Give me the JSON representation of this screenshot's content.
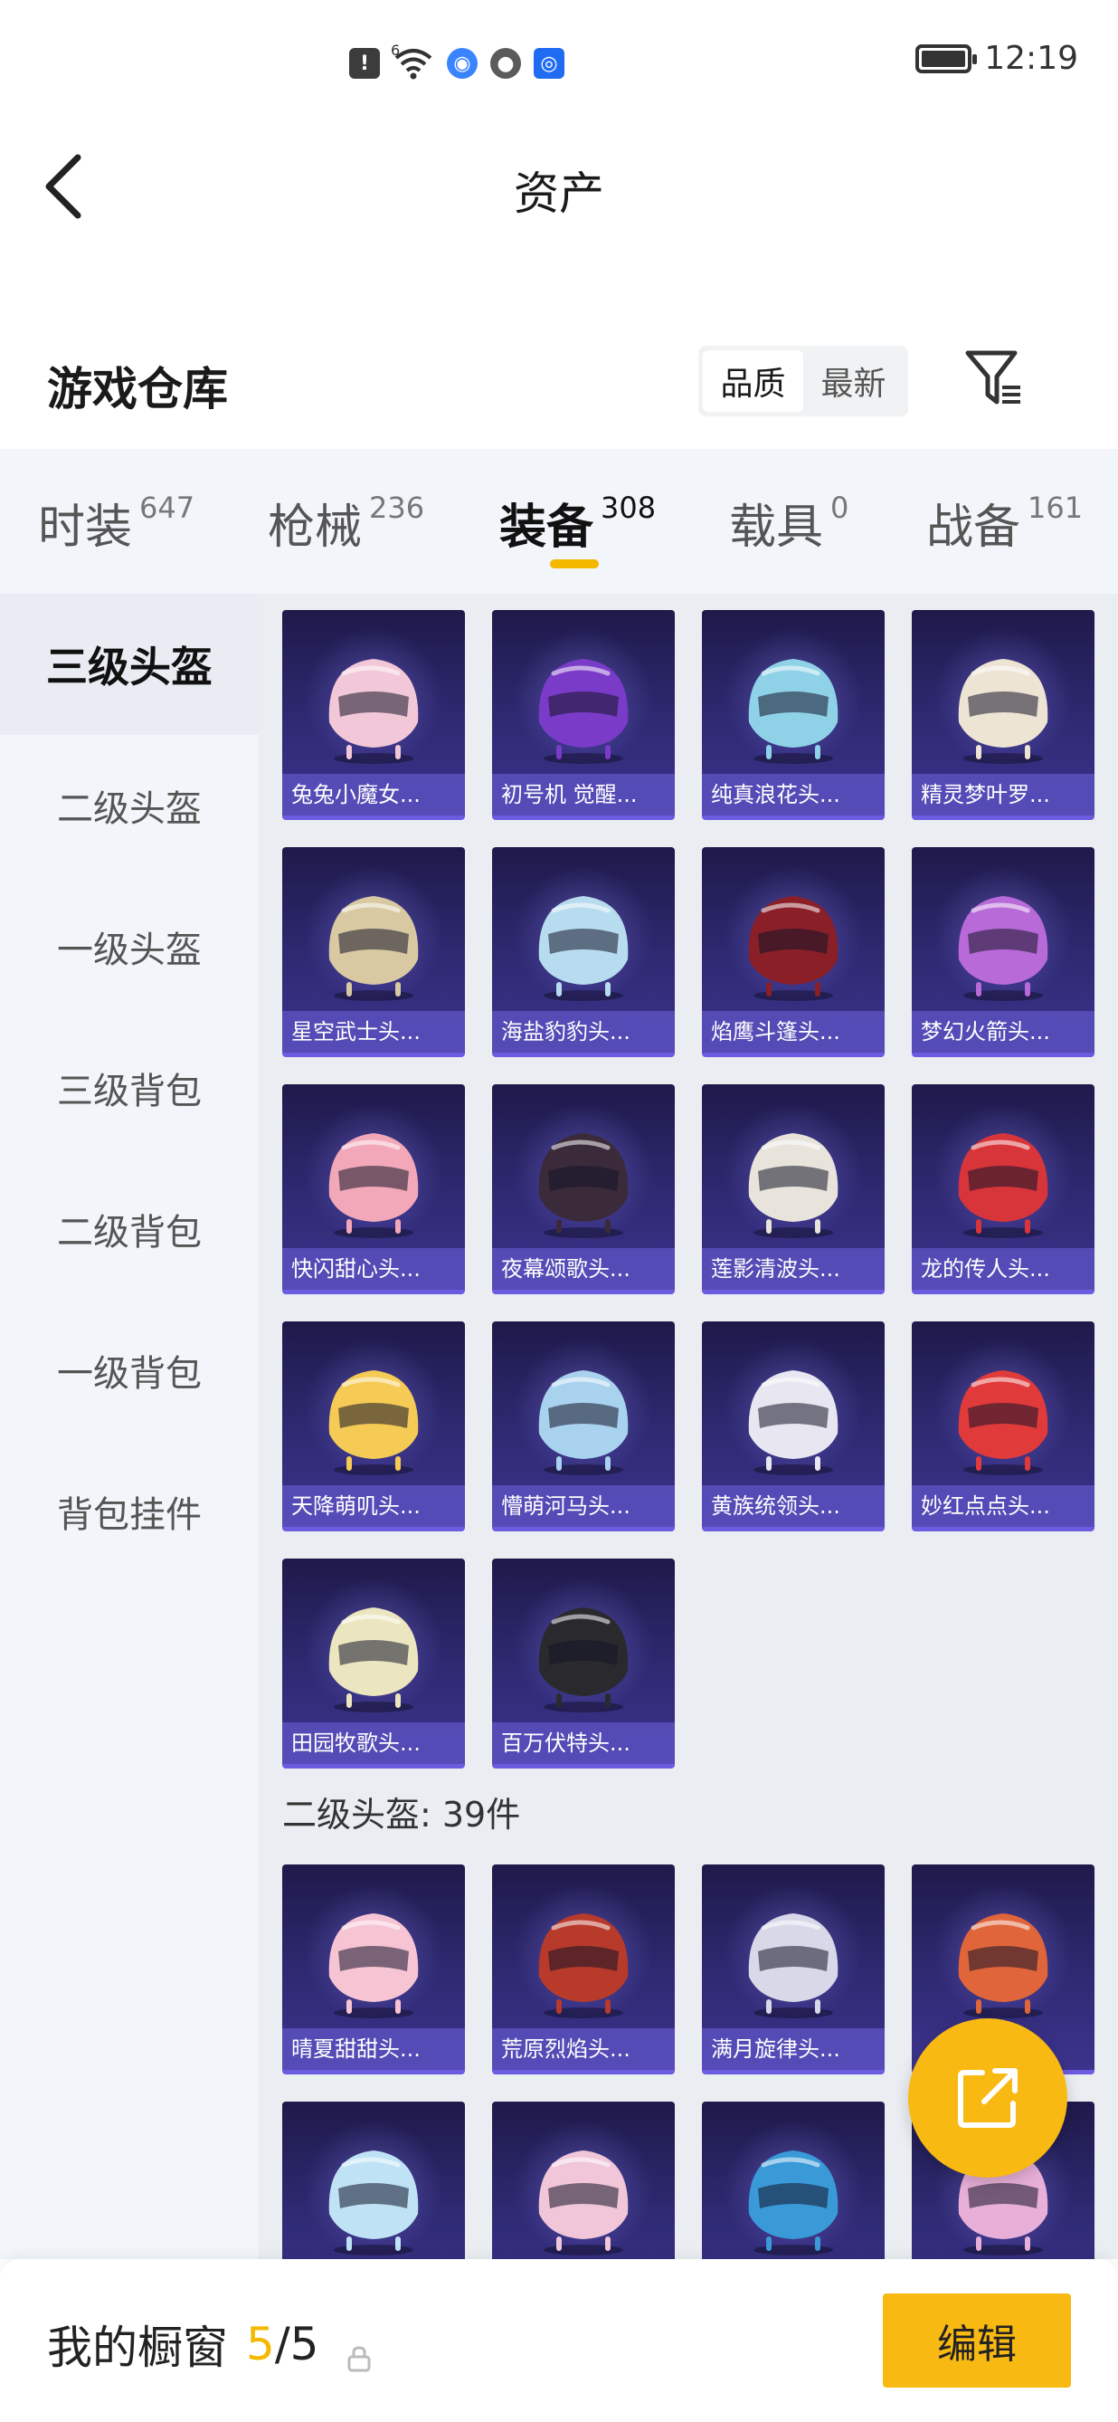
{
  "status_bar": {
    "time": "12:19",
    "signal_superscript": "6",
    "icons": [
      "alert-icon",
      "wifi-icon",
      "browser-icon",
      "wechat-icon",
      "app-icon"
    ]
  },
  "header": {
    "title": "资产"
  },
  "warehouse": {
    "title": "游戏仓库",
    "sort_options": [
      "品质",
      "最新"
    ],
    "active_sort": "品质"
  },
  "categories": [
    {
      "label": "时装",
      "count": "647"
    },
    {
      "label": "枪械",
      "count": "236"
    },
    {
      "label": "装备",
      "count": "308",
      "active": true
    },
    {
      "label": "载具",
      "count": "0"
    },
    {
      "label": "战备",
      "count": "161"
    }
  ],
  "sidebar": {
    "items": [
      {
        "label": "三级头盔",
        "active": true
      },
      {
        "label": "二级头盔"
      },
      {
        "label": "一级头盔"
      },
      {
        "label": "三级背包"
      },
      {
        "label": "二级背包"
      },
      {
        "label": "一级背包"
      },
      {
        "label": "背包挂件"
      }
    ]
  },
  "items_level3": [
    {
      "name": "兔兔小魔女...",
      "color": "#f2c8d8"
    },
    {
      "name": "初号机 觉醒...",
      "color": "#7a3cc8"
    },
    {
      "name": "纯真浪花头...",
      "color": "#8fd2e8"
    },
    {
      "name": "精灵梦叶罗...",
      "color": "#eee4d4"
    },
    {
      "name": "星空武士头...",
      "color": "#d8c9a2"
    },
    {
      "name": "海盐豹豹头...",
      "color": "#b8dcef"
    },
    {
      "name": "焰鹰斗篷头...",
      "color": "#8a1f28"
    },
    {
      "name": "梦幻火箭头...",
      "color": "#b86ad8"
    },
    {
      "name": "快闪甜心头...",
      "color": "#f2a8b8"
    },
    {
      "name": "夜幕颂歌头...",
      "color": "#3a2a3a"
    },
    {
      "name": "莲影清波头...",
      "color": "#e8e4dc"
    },
    {
      "name": "龙的传人头...",
      "color": "#d8353a"
    },
    {
      "name": "天降萌叽头...",
      "color": "#f5cb55"
    },
    {
      "name": "懵萌河马头...",
      "color": "#a8d2ee"
    },
    {
      "name": "黄族统领头...",
      "color": "#e8e6f0"
    },
    {
      "name": "妙红点点头...",
      "color": "#e03a3a"
    },
    {
      "name": "田园牧歌头...",
      "color": "#ece6c0"
    },
    {
      "name": "百万伏特头...",
      "color": "#2a2a2e"
    }
  ],
  "section_level2": {
    "title": "二级头盔: 39件"
  },
  "items_level2": [
    {
      "name": "晴夏甜甜头...",
      "color": "#f7c4d4"
    },
    {
      "name": "荒原烈焰头...",
      "color": "#b83a2a"
    },
    {
      "name": "满月旋律头...",
      "color": "#d8d8e8"
    },
    {
      "name": "",
      "color": "#e0653a"
    },
    {
      "name": "",
      "color": "#bfe2f5"
    },
    {
      "name": "",
      "color": "#f0c6d8"
    },
    {
      "name": "",
      "color": "#3a9ad8"
    },
    {
      "name": "",
      "color": "#e8b0d8"
    }
  ],
  "bottom_bar": {
    "label": "我的橱窗",
    "current": "5",
    "total": "/5",
    "edit_label": "编辑"
  }
}
